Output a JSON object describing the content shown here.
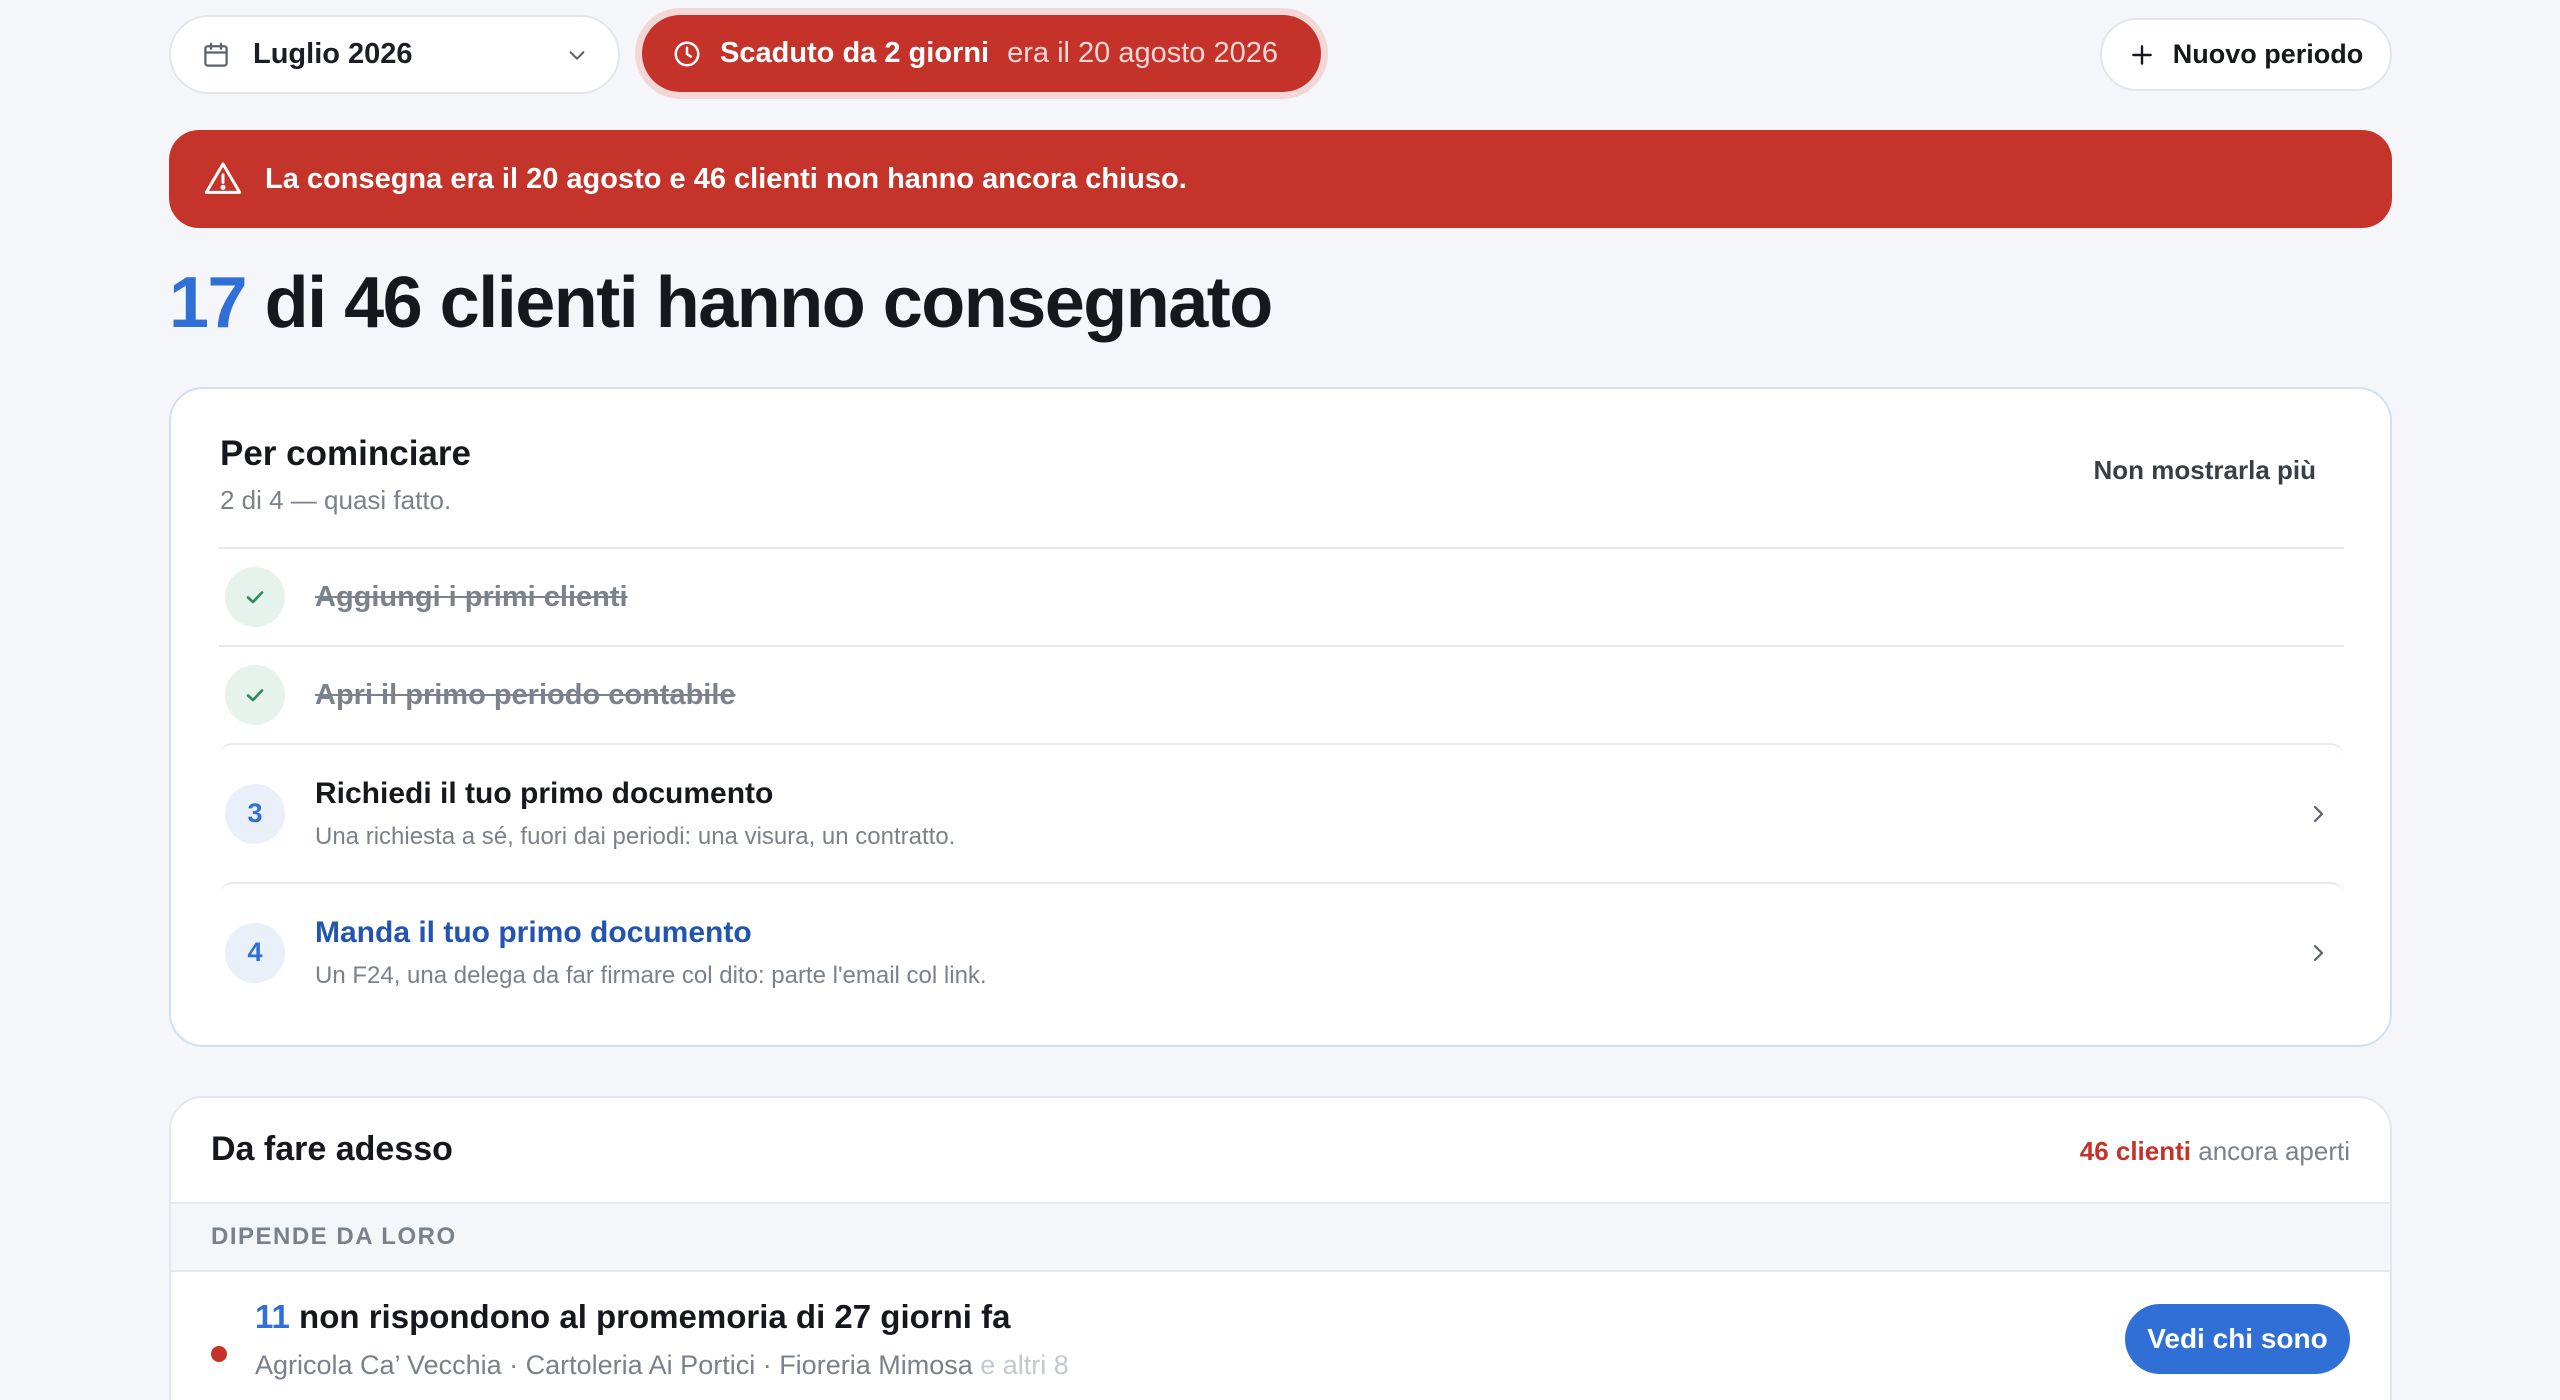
{
  "topbar": {
    "period_label": "Luglio 2026",
    "overdue_strong": "Scaduto da 2 giorni",
    "overdue_soft": "era il 20 agosto 2026",
    "new_period_label": "Nuovo periodo"
  },
  "alert": {
    "text": "La consegna era il 20 agosto e 46 clienti non hanno ancora chiuso."
  },
  "headline": {
    "count": "17",
    "text": " di 46 clienti hanno consegnato"
  },
  "onboarding": {
    "title": "Per cominciare",
    "subtitle": "2 di 4 — quasi fatto.",
    "dismiss_label": "Non mostrarla più",
    "steps": [
      {
        "label": "Aggiungi i primi clienti",
        "done": true
      },
      {
        "label": "Apri il primo periodo contabile",
        "done": true
      },
      {
        "number": "3",
        "label": "Richiedi il tuo primo documento",
        "description": "Una richiesta a sé, fuori dai periodi: una visura, un contratto.",
        "done": false
      },
      {
        "number": "4",
        "label": "Manda il tuo primo documento",
        "description": "Un F24, una delega da far firmare col dito: parte l'email col link.",
        "done": false
      }
    ]
  },
  "todo": {
    "title": "Da fare adesso",
    "count_strong": "46 clienti",
    "count_soft": " ancora aperti",
    "section_label": "DIPENDE DA LORO",
    "rows": [
      {
        "count": "11",
        "title": " non rispondono al promemoria di 27 giorni fa",
        "clients": "Agricola Ca’ Vecchia · Cartoleria Ai Portici · Fioreria Mimosa",
        "more": " e altri 8",
        "button_label": "Vedi chi sono"
      }
    ]
  },
  "colors": {
    "accent_blue": "#2f6fd6",
    "danger_red": "#c43229",
    "success_green": "#2e8a5e"
  },
  "icons": {
    "calendar": "calendar-icon",
    "chevron": "chevron-down-icon",
    "clock": "clock-icon",
    "plus": "plus-icon",
    "warning": "warning-icon",
    "check": "check-icon",
    "arrow": "chevron-right-icon"
  }
}
